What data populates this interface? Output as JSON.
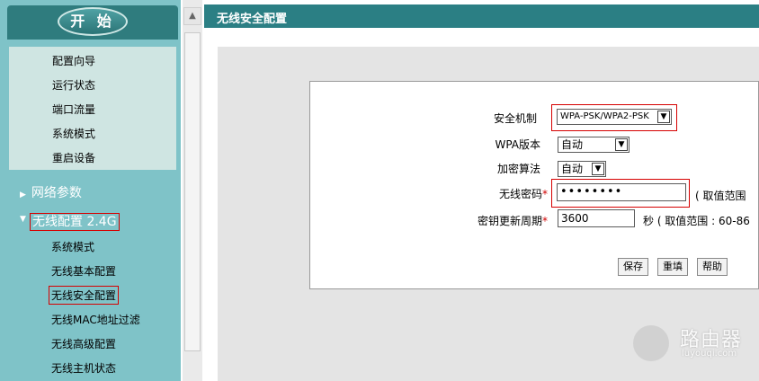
{
  "sidebar": {
    "start_label": "开 始",
    "top_menu": [
      "配置向导",
      "运行状态",
      "端口流量",
      "系统模式",
      "重启设备"
    ],
    "groups": {
      "network_params": "网络参数",
      "wireless_config": "无线配置 2.4G"
    },
    "wireless_items": [
      "系统模式",
      "无线基本配置",
      "无线安全配置",
      "无线MAC地址过滤",
      "无线高级配置",
      "无线主机状态"
    ],
    "active_item": "无线安全配置"
  },
  "page": {
    "title": "无线安全配置"
  },
  "form": {
    "security_mechanism": {
      "label": "安全机制",
      "value": "WPA-PSK/WPA2-PSK"
    },
    "wpa_version": {
      "label": "WPA版本",
      "value": "自动"
    },
    "encryption": {
      "label": "加密算法",
      "value": "自动"
    },
    "password": {
      "label": "无线密码",
      "required_mark": "*",
      "value": "••••••••",
      "hint": "( 取值范围"
    },
    "rekey_period": {
      "label": "密钥更新周期",
      "required_mark": "*",
      "value": "3600",
      "hint": "秒 ( 取值范围 : 60-86"
    }
  },
  "buttons": {
    "save": "保存",
    "reset": "重填",
    "help": "帮助"
  },
  "watermark": {
    "name": "路由器",
    "url": "luyouqi.com"
  },
  "colors": {
    "sidebar_bg": "#7fc3c8",
    "titlebar_bg": "#2b7f84",
    "highlight": "#d60000"
  }
}
